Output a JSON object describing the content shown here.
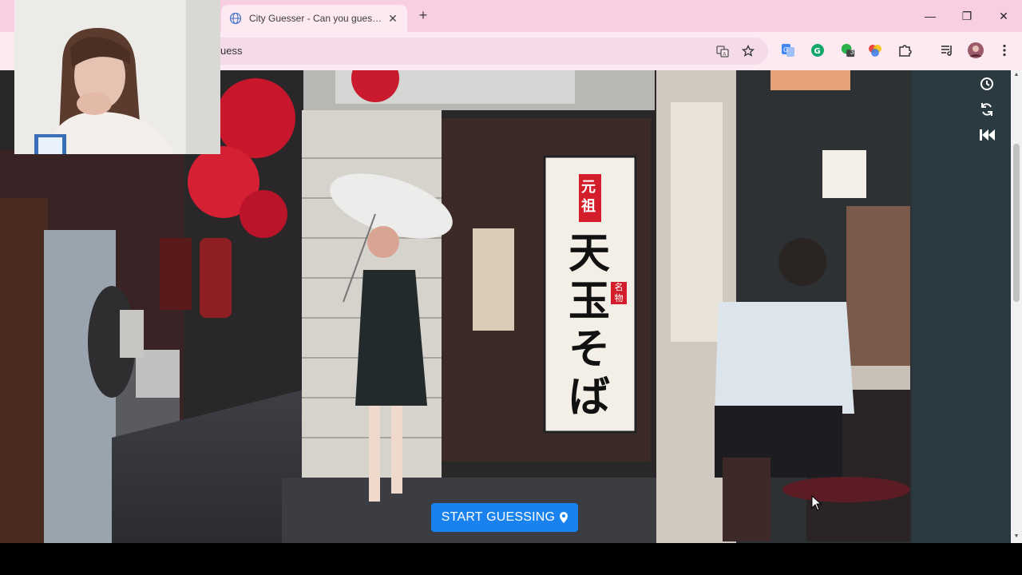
{
  "browser": {
    "tab_title": "City Guesser - Can you guess w",
    "new_tab": "+",
    "address_text": "uess"
  },
  "window_controls": {
    "minimize": "—",
    "restore": "❐",
    "close": "✕"
  },
  "toolbar_icons": [
    "translate-icon",
    "star-icon",
    "google-translate-icon",
    "grammarly-icon",
    "extension-badge-icon",
    "color-wheel-icon",
    "puzzle-icon",
    "media-queue-icon",
    "profile-avatar",
    "menu-icon"
  ],
  "extension_badge": "3",
  "game": {
    "start_button": "START GUESSING",
    "side_controls": [
      "clock-icon",
      "refresh-icon",
      "skip-back-icon"
    ]
  },
  "scene_sign": {
    "top": "元祖",
    "main": "天玉そば",
    "stamp": "名物"
  },
  "colors": {
    "tab_strip": "#f7cfe0",
    "toolbar": "#fde9f2",
    "accent_button": "#1a82ee"
  }
}
